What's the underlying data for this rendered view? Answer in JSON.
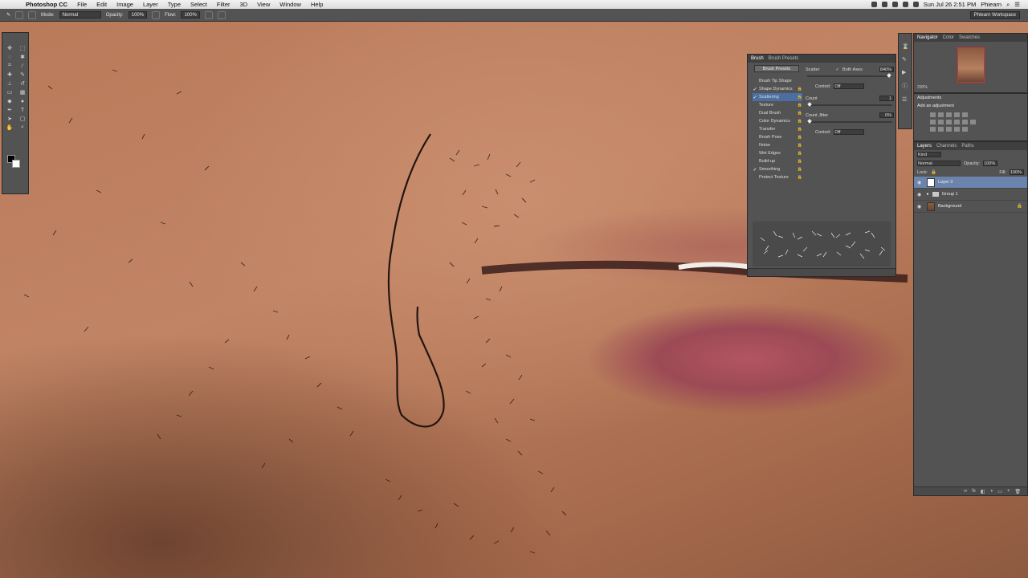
{
  "menubar": {
    "app_name": "Photoshop CC",
    "items": [
      "File",
      "Edit",
      "Image",
      "Layer",
      "Type",
      "Select",
      "Filter",
      "3D",
      "View",
      "Window",
      "Help"
    ],
    "datetime": "Sun Jul 26  2:51 PM",
    "user": "Phiearn"
  },
  "options_bar": {
    "mode_label": "Mode:",
    "mode_value": "Normal",
    "opacity_label": "Opacity:",
    "opacity_value": "100%",
    "flow_label": "Flow:",
    "flow_value": "100%",
    "workspace": "Phlearn Workspace"
  },
  "brush_panel": {
    "tabs": [
      "Brush",
      "Brush Presets"
    ],
    "presets_button": "Brush Presets",
    "list": [
      {
        "label": "Brush Tip Shape",
        "checked": false
      },
      {
        "label": "Shape Dynamics",
        "checked": true
      },
      {
        "label": "Scattering",
        "checked": true
      },
      {
        "label": "Texture",
        "checked": false
      },
      {
        "label": "Dual Brush",
        "checked": false
      },
      {
        "label": "Color Dynamics",
        "checked": false
      },
      {
        "label": "Transfer",
        "checked": false
      },
      {
        "label": "Brush Pose",
        "checked": false
      },
      {
        "label": "Noise",
        "checked": false
      },
      {
        "label": "Wet Edges",
        "checked": false
      },
      {
        "label": "Build-up",
        "checked": false
      },
      {
        "label": "Smoothing",
        "checked": true
      },
      {
        "label": "Protect Texture",
        "checked": false
      }
    ],
    "scatter_label": "Scatter",
    "both_axes_label": "Both Axes",
    "scatter_value": "840%",
    "control_label": "Control:",
    "control_value": "Off",
    "count_label": "Count",
    "count_value": "1",
    "count_jitter_label": "Count Jitter",
    "count_jitter_value": "0%",
    "control2_label": "Control:",
    "control2_value": "Off"
  },
  "navigator": {
    "tabs": [
      "Navigator",
      "Color",
      "Swatches"
    ],
    "zoom": "200%"
  },
  "adjustments": {
    "title": "Adjustments",
    "subtitle": "Add an adjustment"
  },
  "layers": {
    "tabs": [
      "Layers",
      "Channels",
      "Paths"
    ],
    "kind": "Kind",
    "blend_mode": "Normal",
    "opacity_label": "Opacity:",
    "opacity_value": "100%",
    "lock_label": "Lock:",
    "fill_label": "Fill:",
    "fill_value": "100%",
    "rows": [
      {
        "name": "Layer 3",
        "type": "layer"
      },
      {
        "name": "Group 1",
        "type": "group"
      },
      {
        "name": "Background",
        "type": "photo"
      }
    ]
  },
  "colors": {
    "panel": "#535353",
    "selection": "#4b6fa3",
    "active_layer": "#6b84ad"
  }
}
